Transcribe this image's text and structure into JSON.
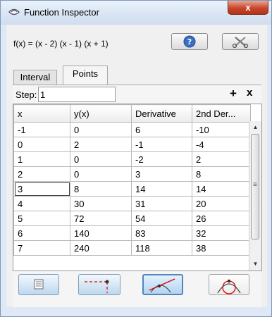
{
  "window": {
    "title": "Function Inspector",
    "close_label": "x"
  },
  "function_bar": {
    "definition": "f(x) = (x - 2) (x - 1) (x + 1)"
  },
  "tabs": [
    {
      "label": "Interval",
      "selected": false
    },
    {
      "label": "Points",
      "selected": true
    }
  ],
  "points_panel": {
    "step_label": "Step:",
    "step_value": "1",
    "add_label": "+",
    "remove_label": "x"
  },
  "table": {
    "columns": [
      "x",
      "y(x)",
      "Derivative",
      "2nd Der..."
    ],
    "rows": [
      [
        "-1",
        "0",
        "6",
        "-10"
      ],
      [
        "0",
        "2",
        "-1",
        "-4"
      ],
      [
        "1",
        "0",
        "-2",
        "2"
      ],
      [
        "2",
        "0",
        "3",
        "8"
      ],
      [
        "3",
        "8",
        "14",
        "14"
      ],
      [
        "4",
        "30",
        "31",
        "20"
      ],
      [
        "5",
        "72",
        "54",
        "26"
      ],
      [
        "6",
        "140",
        "83",
        "32"
      ],
      [
        "7",
        "240",
        "118",
        "38"
      ]
    ],
    "selected_row": 4
  },
  "scrollbar": {
    "up_arrow": "▲",
    "down_arrow": "▼",
    "grip": "≡"
  },
  "icons": {
    "title": "function-inspector-icon",
    "help": "help-icon",
    "tools": "tools-icon",
    "table_view": "table-icon",
    "trace": "trace-point-icon",
    "tangent": "tangent-line-icon",
    "osculating": "osculating-circle-icon"
  },
  "colors": {
    "window_background": "#dfe9f5",
    "close_button": "#c9462c",
    "selected_toggle": "#4f87bd"
  }
}
